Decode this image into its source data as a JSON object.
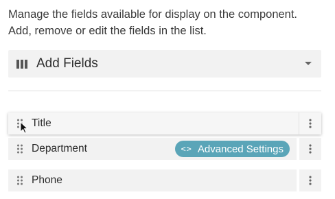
{
  "description": {
    "line1": "Manage the fields available for display on the component.",
    "line2": "Add, remove or edit the fields in the list."
  },
  "add_fields": {
    "label": "Add Fields",
    "icon": "columns-icon",
    "caret_icon": "caret-down-icon"
  },
  "fields": [
    {
      "label": "Title",
      "state": "dragging"
    },
    {
      "label": "Department",
      "badge": "Advanced Settings",
      "badge_icon": "code-icon",
      "badge_color": "#5aa5b8"
    },
    {
      "label": "Phone"
    }
  ],
  "icons": {
    "drag_handle": "drag-handle-icon",
    "row_menu": "more-vertical-icon",
    "pointer": "mouse-pointer-icon"
  },
  "colors": {
    "row_background": "#f2f2f2",
    "accent": "#5aa5b8",
    "text": "#333333"
  }
}
